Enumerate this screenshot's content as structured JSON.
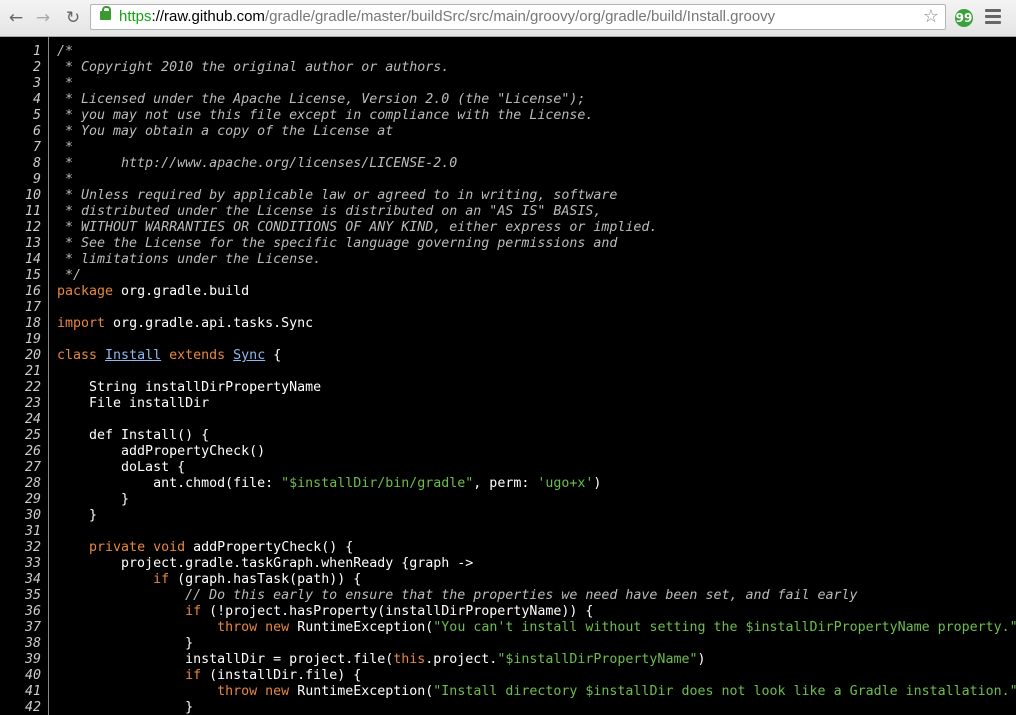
{
  "browser": {
    "back_glyph": "←",
    "forward_glyph": "→",
    "reload_glyph": "↻",
    "url_scheme": "https",
    "url_sep": "://",
    "url_host": "raw.github.com",
    "url_path": "/gradle/gradle/master/buildSrc/src/main/groovy/org/gradle/build/Install.groovy",
    "star_glyph": "☆",
    "extension_glyph": "99"
  },
  "code_lines": [
    [
      {
        "t": "/*",
        "c": "c"
      }
    ],
    [
      {
        "t": " * Copyright 2010 the original author or authors.",
        "c": "c"
      }
    ],
    [
      {
        "t": " *",
        "c": "c"
      }
    ],
    [
      {
        "t": " * Licensed under the Apache License, Version 2.0 (the \"License\");",
        "c": "c"
      }
    ],
    [
      {
        "t": " * you may not use this file except in compliance with the License.",
        "c": "c"
      }
    ],
    [
      {
        "t": " * You may obtain a copy of the License at",
        "c": "c"
      }
    ],
    [
      {
        "t": " *",
        "c": "c"
      }
    ],
    [
      {
        "t": " *      http://www.apache.org/licenses/LICENSE-2.0",
        "c": "c"
      }
    ],
    [
      {
        "t": " *",
        "c": "c"
      }
    ],
    [
      {
        "t": " * Unless required by applicable law or agreed to in writing, software",
        "c": "c"
      }
    ],
    [
      {
        "t": " * distributed under the License is distributed on an \"AS IS\" BASIS,",
        "c": "c"
      }
    ],
    [
      {
        "t": " * WITHOUT WARRANTIES OR CONDITIONS OF ANY KIND, either express or implied.",
        "c": "c"
      }
    ],
    [
      {
        "t": " * See the License for the specific language governing permissions and",
        "c": "c"
      }
    ],
    [
      {
        "t": " * limitations under the License.",
        "c": "c"
      }
    ],
    [
      {
        "t": " */",
        "c": "c"
      }
    ],
    [
      {
        "t": "package",
        "c": "kw"
      },
      {
        "t": " org.gradle.build"
      }
    ],
    [],
    [
      {
        "t": "import",
        "c": "kw"
      },
      {
        "t": " org.gradle.api.tasks.Sync"
      }
    ],
    [],
    [
      {
        "t": "class",
        "c": "kw"
      },
      {
        "t": " "
      },
      {
        "t": "Install",
        "c": "lnk"
      },
      {
        "t": " "
      },
      {
        "t": "extends",
        "c": "kw"
      },
      {
        "t": " "
      },
      {
        "t": "Sync",
        "c": "lnk"
      },
      {
        "t": " {"
      }
    ],
    [],
    [
      {
        "t": "    String installDirPropertyName"
      }
    ],
    [
      {
        "t": "    File installDir"
      }
    ],
    [],
    [
      {
        "t": "    def Install() {"
      }
    ],
    [
      {
        "t": "        addPropertyCheck()"
      }
    ],
    [
      {
        "t": "        doLast {"
      }
    ],
    [
      {
        "t": "            ant.chmod(file: "
      },
      {
        "t": "\"$installDir/bin/gradle\"",
        "c": "str"
      },
      {
        "t": ", perm: "
      },
      {
        "t": "'ugo+x'",
        "c": "str"
      },
      {
        "t": ")"
      }
    ],
    [
      {
        "t": "        }"
      }
    ],
    [
      {
        "t": "    }"
      }
    ],
    [],
    [
      {
        "t": "    "
      },
      {
        "t": "private",
        "c": "kw"
      },
      {
        "t": " "
      },
      {
        "t": "void",
        "c": "kw"
      },
      {
        "t": " addPropertyCheck() {"
      }
    ],
    [
      {
        "t": "        project.gradle.taskGraph.whenReady {graph ->"
      }
    ],
    [
      {
        "t": "            "
      },
      {
        "t": "if",
        "c": "kw"
      },
      {
        "t": " (graph.hasTask(path)) {"
      }
    ],
    [
      {
        "t": "                // Do this early to ensure that the properties we need have been set, and fail early",
        "c": "c"
      }
    ],
    [
      {
        "t": "                "
      },
      {
        "t": "if",
        "c": "kw"
      },
      {
        "t": " (!project.hasProperty(installDirPropertyName)) {"
      }
    ],
    [
      {
        "t": "                    "
      },
      {
        "t": "throw",
        "c": "kw"
      },
      {
        "t": " "
      },
      {
        "t": "new",
        "c": "kw"
      },
      {
        "t": " RuntimeException("
      },
      {
        "t": "\"You can't install without setting the $installDirPropertyName property.\"",
        "c": "str"
      },
      {
        "t": ")"
      }
    ],
    [
      {
        "t": "                }"
      }
    ],
    [
      {
        "t": "                installDir = project.file("
      },
      {
        "t": "this",
        "c": "kw"
      },
      {
        "t": ".project."
      },
      {
        "t": "\"$installDirPropertyName\"",
        "c": "str"
      },
      {
        "t": ")"
      }
    ],
    [
      {
        "t": "                "
      },
      {
        "t": "if",
        "c": "kw"
      },
      {
        "t": " (installDir.file) {"
      }
    ],
    [
      {
        "t": "                    "
      },
      {
        "t": "throw",
        "c": "kw"
      },
      {
        "t": " "
      },
      {
        "t": "new",
        "c": "kw"
      },
      {
        "t": " RuntimeException("
      },
      {
        "t": "\"Install directory $installDir does not look like a Gradle installation.\"",
        "c": "str"
      },
      {
        "t": ")"
      }
    ],
    [
      {
        "t": "                }"
      }
    ]
  ]
}
